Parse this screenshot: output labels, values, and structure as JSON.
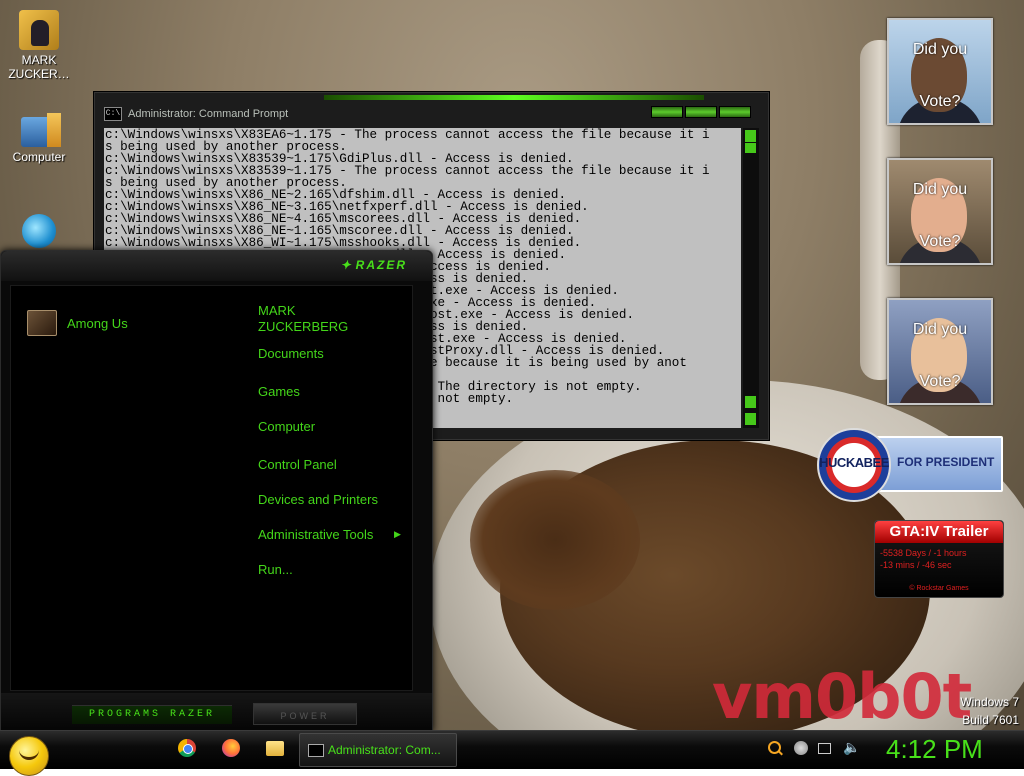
{
  "desktop": {
    "icons": [
      {
        "label": "MARK ZUCKER…"
      },
      {
        "label": "Computer"
      },
      {
        "label": ""
      }
    ]
  },
  "cmd_window": {
    "title": "Administrator: Command Prompt",
    "lines": [
      "c:\\Windows\\winsxs\\X83EA6~1.175 - The process cannot access the file because it i",
      "s being used by another process.",
      "c:\\Windows\\winsxs\\X83539~1.175\\GdiPlus.dll - Access is denied.",
      "c:\\Windows\\winsxs\\X83539~1.175 - The process cannot access the file because it i",
      "s being used by another process.",
      "c:\\Windows\\winsxs\\X86_NE~2.165\\dfshim.dll - Access is denied.",
      "c:\\Windows\\winsxs\\X86_NE~3.165\\netfxperf.dll - Access is denied.",
      "c:\\Windows\\winsxs\\X86_NE~4.165\\mscorees.dll - Access is denied.",
      "c:\\Windows\\winsxs\\X86_NE~1.165\\mscoree.dll - Access is denied.",
      "c:\\Windows\\winsxs\\X86_WI~1.175\\msshooks.dll - Access is denied.",
      "                                     .dll - Access is denied.",
      "                                     ll - Access is denied.",
      "                                     - Access is denied.",
      "                                     terHost.exe - Access is denied.",
      "                                     exer.exe - Access is denied.",
      "                                     tocolHost.exe - Access is denied.",
      "                                     - Access is denied.",
      "                                     tionHost.exe - Access is denied.",
      "                                     tionHostProxy.dll - Access is denied.",
      "                                     he file because it is being used by anot",
      "",
      "                                     TO~1 - The directory is not empty.",
      "                                     ory is not empty."
    ]
  },
  "start_menu": {
    "logo": "RAZER",
    "program": "Among Us",
    "right_items": [
      "MARK ZUCKERBERG",
      "Documents",
      "Games",
      "Computer",
      "Control Panel",
      "Devices and Printers",
      "Administrative Tools",
      "Run..."
    ],
    "programs_label": "PROGRAMS RAZER",
    "power_label": "POWER"
  },
  "gadgets": {
    "vote": [
      {
        "line1": "Did you",
        "line2": "Vote?"
      },
      {
        "line1": "Did you",
        "line2": "Vote?"
      },
      {
        "line1": "Did you",
        "line2": "Vote?"
      }
    ],
    "huckabee": {
      "badge": "HUCKABEE",
      "text": "FOR PRESIDENT"
    },
    "gta": {
      "title": "GTA:IV Trailer",
      "line1": "-5538 Days / -1 hours",
      "line2": "-13 mins / -46 sec",
      "copyright": "© Rockstar Games"
    }
  },
  "watermark": "vm0b0t",
  "os": {
    "name": "Windows 7",
    "build": "Build 7601"
  },
  "taskbar": {
    "pinned": [
      "chrome-icon",
      "firefox-icon",
      "explorer-icon"
    ],
    "active_window": "Administrator: Com...",
    "clock": "4:12 PM"
  },
  "colors": {
    "accent": "#48e01a",
    "cmd_bg": "#c0c0c0",
    "watermark": "#d22a3a"
  }
}
